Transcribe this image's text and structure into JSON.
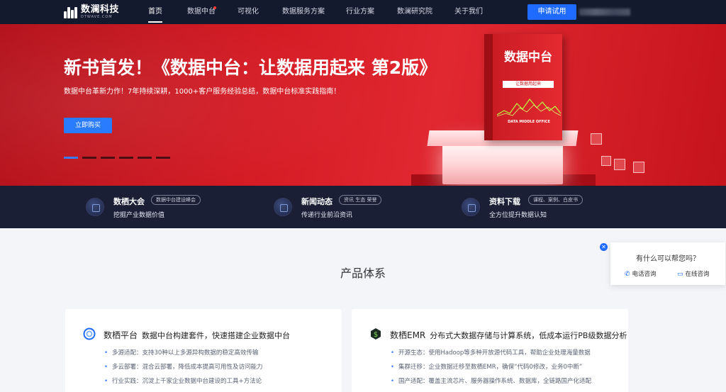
{
  "nav": {
    "logo_name": "数澜科技",
    "logo_sub": "DTWAVE.COM",
    "items": [
      {
        "label": "首页",
        "active": true
      },
      {
        "label": "数据中台",
        "dot": true
      },
      {
        "label": "可视化"
      },
      {
        "label": "数据服务方案"
      },
      {
        "label": "行业方案"
      },
      {
        "label": "数澜研究院"
      },
      {
        "label": "关于我们"
      }
    ],
    "apply_label": "申请试用"
  },
  "hero": {
    "title": "新书首发！《数据中台：让数据用起来 第2版》",
    "desc": "数据中台革新力作！7年持续深耕，1000+客户服务经验总结，数据中台标准实践指南！",
    "buy_label": "立即购买",
    "book_title": "数据中台",
    "book_subtitle": "让数据用起来",
    "book_en": "DATA MIDDLE OFFICE",
    "slides": 6,
    "active_slide": 0
  },
  "strip": [
    {
      "title": "数栖大会",
      "tag": "数据中台建设峰会",
      "desc": "挖掘产业数据价值"
    },
    {
      "title": "新闻动态",
      "tag": "资讯 生态 荣誉",
      "desc": "传递行业前沿资讯"
    },
    {
      "title": "资料下载",
      "tag": "课程、案例、白皮书",
      "desc": "全方位提升数据认知"
    }
  ],
  "section": {
    "title": "产品体系",
    "cards": [
      {
        "name": "数栖平台",
        "desc": "数据中台构建套件，快速搭建企业数据中台",
        "icon": "ring-icon",
        "points": [
          "多源适配：支持30种以上多源异构数据的稳定高效传输",
          "多云部署：混合云部署，降低成本提高可用性及访问能力",
          "行业实践：沉淀上千家企业数据中台建设的工具+方法论"
        ]
      },
      {
        "name": "数栖EMR",
        "desc": "分布式大数据存储与计算系统，低成本运行PB级数据分析",
        "icon": "dollar-hex-icon",
        "points": [
          "开源生态：使用Hadoop等多种开放源代码工具，帮助企业处理海量数据",
          "集群迁移：企业数据迁移至数栖EMR，确保“代码0修改，业务0中断”",
          "国产适配：覆盖主流芯片、服务器操作系统、数据库，全链路国产化适配"
        ]
      }
    ]
  },
  "float": {
    "question": "有什么可以帮您吗？",
    "phone_label": "电话咨询",
    "online_label": "在线咨询"
  },
  "colors": {
    "nav_bg": "#141a2e",
    "hero_red": "#d41a23",
    "accent_blue": "#1f6bff",
    "strip_bg": "#1b1f36"
  }
}
